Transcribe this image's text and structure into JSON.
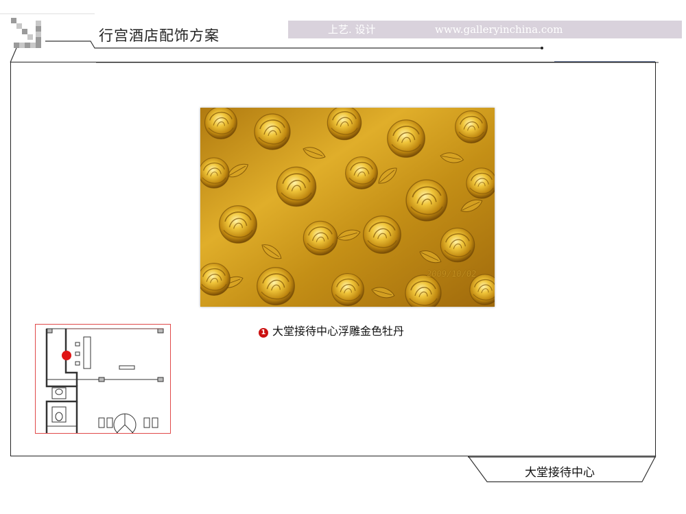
{
  "header": {
    "title": "行宫酒店配饰方案",
    "banner_brand": "上艺. 设计",
    "banner_url": "www.galleryinchina.com"
  },
  "photo": {
    "date_stamp": "2009/10/02"
  },
  "caption": {
    "marker": "1",
    "text": "大堂接待中心浮雕金色牡丹"
  },
  "floor_plan": {
    "location_marker": "1"
  },
  "footer": {
    "section_label": "大堂接待中心"
  },
  "colors": {
    "banner_bg": "#d9d2dc",
    "marker_red": "#cc1111",
    "gold": "#d6a21e",
    "plan_border": "#e04848"
  }
}
